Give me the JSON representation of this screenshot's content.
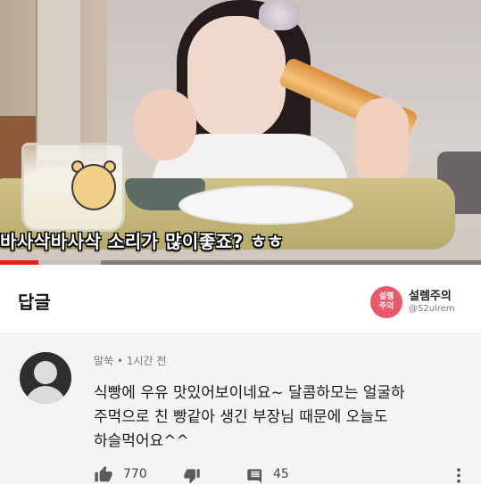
{
  "video": {
    "caption": "바사삭바사삭 소리가 많이좋죠? ㅎㅎ",
    "progress_fraction": 0.08,
    "buffered_fraction": 0.21
  },
  "reply_header": {
    "title": "답글",
    "channel": {
      "logo_text": "설렘\n주의",
      "name": "설렘주의",
      "handle": "@S2ulrem"
    }
  },
  "comment": {
    "author": "말쑥",
    "time": "1시간 전",
    "meta_separator": "•",
    "lines": [
      "식빵에 우유 맛있어보이네요~ 달콤하모는 얼굴하",
      "주먹으로 친 빵같아 생긴 부장님 때문에 오늘도",
      "하슬먹어요^^"
    ],
    "like_count": "770",
    "reply_count": "45"
  },
  "colors": {
    "progress": "#e62117",
    "channel_logo": "#e85a6b",
    "comment_bg": "#f4f4f4"
  },
  "icons": [
    "thumbs-up-icon",
    "thumbs-down-icon",
    "comment-icon",
    "more-vert-icon"
  ]
}
